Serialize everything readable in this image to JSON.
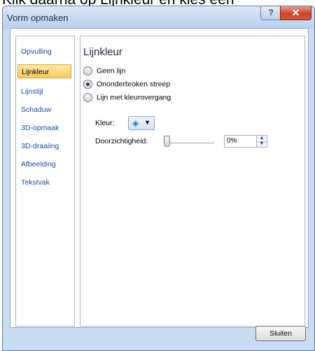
{
  "caption": "Klik daarna op Lijnkleur en kies een",
  "window": {
    "title": "Vorm opmaken",
    "help_label": "?",
    "close_label": "✕"
  },
  "sidebar": {
    "items": [
      {
        "label": "Opvulling"
      },
      {
        "label": "Lijnkleur"
      },
      {
        "label": "Lijnstijl"
      },
      {
        "label": "Schaduw"
      },
      {
        "label": "3D-opmaak"
      },
      {
        "label": "3D-draaiing"
      },
      {
        "label": "Afbeelding"
      },
      {
        "label": "Tekstvak"
      }
    ],
    "selected": "Lijnkleur"
  },
  "main": {
    "title": "Lijnkleur",
    "options": [
      {
        "label": "Geen lijn",
        "checked": false
      },
      {
        "label": "Ononderbroken streep",
        "checked": true
      },
      {
        "label": "Lijn met kleurovergang",
        "checked": false
      }
    ],
    "color_label": "Kleur:",
    "color_icon": "paint-bucket-icon",
    "transparency_label": "Doorzichtigheid:",
    "transparency_value": "0%",
    "transparency_level": 0
  },
  "footer": {
    "close_button": "Sluiten"
  },
  "colors": {
    "accent": "#f8c960",
    "titlebar": "#c9dcf1",
    "close": "#c9432a"
  }
}
